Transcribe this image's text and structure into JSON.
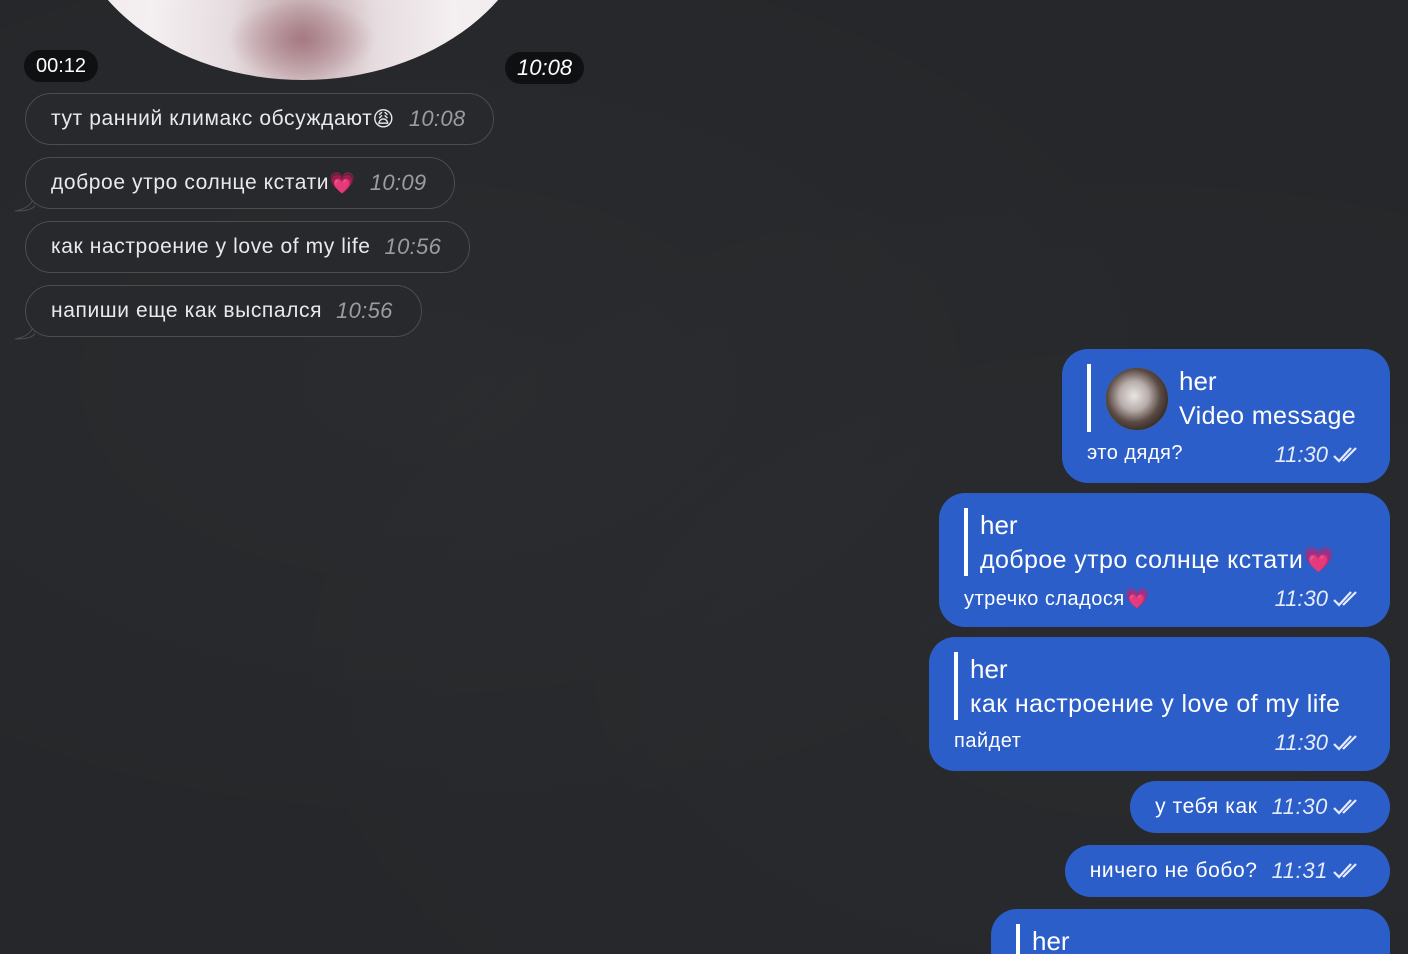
{
  "video_message": {
    "duration": "00:12",
    "time": "10:08"
  },
  "incoming": [
    {
      "text": "тут ранний климакс обсуждают",
      "emoji": "😩",
      "time": "10:08"
    },
    {
      "text": "доброе утро солнце кстати",
      "emoji": "💗",
      "time": "10:09"
    },
    {
      "text": "как настроение у love of my life",
      "emoji": "",
      "time": "10:56"
    },
    {
      "text": "напиши еще как выспался",
      "emoji": "",
      "time": "10:56"
    }
  ],
  "outgoing": [
    {
      "reply_name": "her",
      "reply_text": "Video message",
      "text": "это дядя?",
      "emoji": "",
      "time": "11:30",
      "status": "read-double-check-icon"
    },
    {
      "reply_name": "her",
      "reply_text": "доброе утро солнце кстати💗",
      "text": "утречко сладося",
      "emoji": "💗",
      "time": "11:30",
      "status": "read-double-check-icon"
    },
    {
      "reply_name": "her",
      "reply_text": "как настроение у love of my life",
      "text": "пайдет",
      "emoji": "",
      "time": "11:30",
      "status": "read-double-check-icon"
    },
    {
      "text": "у тебя как",
      "time": "11:30",
      "status": "read-double-check-icon"
    },
    {
      "text": "ничего не бобо?",
      "time": "11:31",
      "status": "read-double-check-icon"
    },
    {
      "reply_name": "her"
    }
  ],
  "colors": {
    "background": "#25272a",
    "incoming_bubble": "#27292c",
    "outgoing_bubble": "#2b5ec9"
  }
}
